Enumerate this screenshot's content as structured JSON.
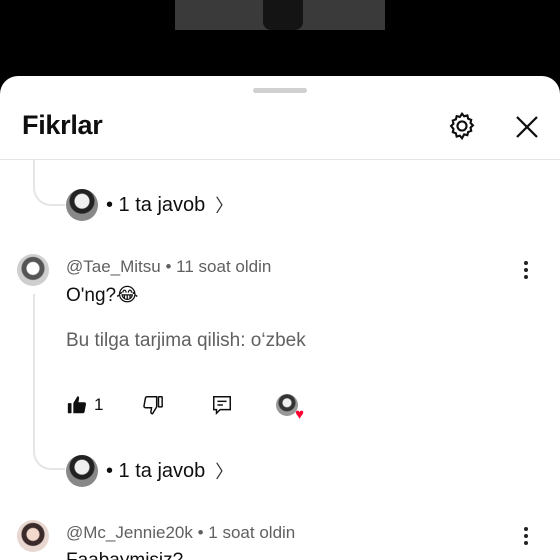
{
  "sheet": {
    "title": "Fikrlar"
  },
  "icons": {
    "settings": "gear-icon",
    "close": "close-icon",
    "like": "thumbs-up-icon",
    "dislike": "thumbs-down-icon",
    "reply": "reply-icon",
    "more": "more-vert-icon"
  },
  "thread_top": {
    "replies_label": "• 1 ta javob"
  },
  "comments": [
    {
      "author": "@Tae_Mitsu",
      "time": "• 11 soat oldin",
      "text": "O'ng?😂",
      "translate": "Bu tilga tarjima qilish: o‘zbek",
      "likes": "1",
      "replies_label": "• 1 ta javob"
    },
    {
      "author": "@Mc_Jennie20k",
      "time": "• 1 soat oldin",
      "text": "Faabaymisiz?"
    }
  ],
  "colors": {
    "heart": "#ff0033",
    "secondary_text": "#606060"
  }
}
